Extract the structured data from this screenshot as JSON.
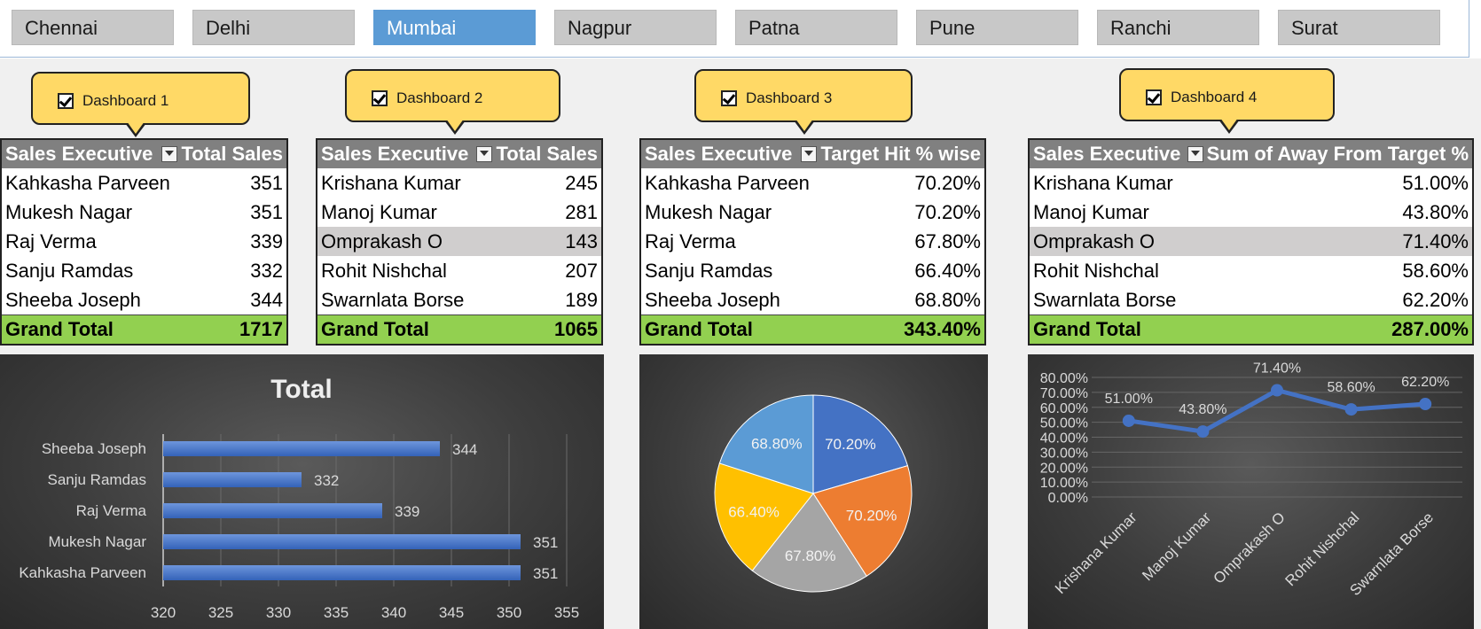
{
  "cities": [
    "Chennai",
    "Delhi",
    "Mumbai",
    "Nagpur",
    "Patna",
    "Pune",
    "Ranchi",
    "Surat"
  ],
  "active_city": "Mumbai",
  "dashboards": [
    "Dashboard 1",
    "Dashboard 2",
    "Dashboard 3",
    "Dashboard 4"
  ],
  "pivots": [
    {
      "header": [
        "Sales Executive",
        "Total Sales"
      ],
      "rows": [
        {
          "name": "Kahkasha Parveen",
          "value": "351"
        },
        {
          "name": "Mukesh Nagar",
          "value": "351"
        },
        {
          "name": "Raj Verma",
          "value": "339"
        },
        {
          "name": "Sanju Ramdas",
          "value": "332"
        },
        {
          "name": "Sheeba Joseph",
          "value": "344"
        }
      ],
      "grand_total_label": "Grand Total",
      "grand_total": "1717"
    },
    {
      "header": [
        "Sales Executive",
        "Total Sales"
      ],
      "rows": [
        {
          "name": "Krishana Kumar",
          "value": "245"
        },
        {
          "name": "Manoj Kumar",
          "value": "281"
        },
        {
          "name": "Omprakash O",
          "value": "143"
        },
        {
          "name": "Rohit Nishchal",
          "value": "207"
        },
        {
          "name": "Swarnlata Borse",
          "value": "189"
        }
      ],
      "grand_total_label": "Grand Total",
      "grand_total": "1065"
    },
    {
      "header": [
        "Sales Executive",
        "Target Hit % wise"
      ],
      "rows": [
        {
          "name": "Kahkasha Parveen",
          "value": "70.20%"
        },
        {
          "name": "Mukesh Nagar",
          "value": "70.20%"
        },
        {
          "name": "Raj Verma",
          "value": "67.80%"
        },
        {
          "name": "Sanju Ramdas",
          "value": "66.40%"
        },
        {
          "name": "Sheeba Joseph",
          "value": "68.80%"
        }
      ],
      "grand_total_label": "Grand Total",
      "grand_total": "343.40%"
    },
    {
      "header": [
        "Sales Executive",
        "Sum of Away From Target %"
      ],
      "rows": [
        {
          "name": "Krishana Kumar",
          "value": "51.00%"
        },
        {
          "name": "Manoj Kumar",
          "value": "43.80%"
        },
        {
          "name": "Omprakash O",
          "value": "71.40%"
        },
        {
          "name": "Rohit Nishchal",
          "value": "58.60%"
        },
        {
          "name": "Swarnlata Borse",
          "value": "62.20%"
        }
      ],
      "grand_total_label": "Grand Total",
      "grand_total": "287.00%"
    }
  ],
  "colors": {
    "active_tab": "#5b9bd5",
    "grand_total_bg": "#92d050",
    "callout": "#ffd966",
    "bar": "#4472c4",
    "pie": [
      "#4472c4",
      "#ed7d31",
      "#a5a5a5",
      "#ffc000",
      "#5b9bd5"
    ]
  },
  "chart_data": [
    {
      "type": "bar",
      "title": "Total",
      "categories": [
        "Kahkasha Parveen",
        "Mukesh Nagar",
        "Raj Verma",
        "Sanju Ramdas",
        "Sheeba Joseph"
      ],
      "values": [
        351,
        351,
        339,
        332,
        344
      ],
      "xlim": [
        320,
        355
      ],
      "xticks": [
        320,
        325,
        330,
        335,
        340,
        345,
        350,
        355
      ],
      "grid": true
    },
    {
      "type": "pie",
      "labels": [
        "Kahkasha Parveen",
        "Mukesh Nagar",
        "Raj Verma",
        "Sanju Ramdas",
        "Sheeba Joseph"
      ],
      "values": [
        70.2,
        70.2,
        67.8,
        66.4,
        68.8
      ],
      "data_labels": [
        "70.20%",
        "70.20%",
        "67.80%",
        "66.40%",
        "68.80%"
      ]
    },
    {
      "type": "line",
      "categories": [
        "Krishana Kumar",
        "Manoj Kumar",
        "Omprakash O",
        "Rohit Nishchal",
        "Swarnlata Borse"
      ],
      "values": [
        51.0,
        43.8,
        71.4,
        58.6,
        62.2
      ],
      "data_labels": [
        "51.00%",
        "43.80%",
        "71.40%",
        "58.60%",
        "62.20%"
      ],
      "ylim": [
        0,
        80
      ],
      "yticks": [
        "0.00%",
        "10.00%",
        "20.00%",
        "30.00%",
        "40.00%",
        "50.00%",
        "60.00%",
        "70.00%",
        "80.00%"
      ],
      "grid": true
    }
  ]
}
